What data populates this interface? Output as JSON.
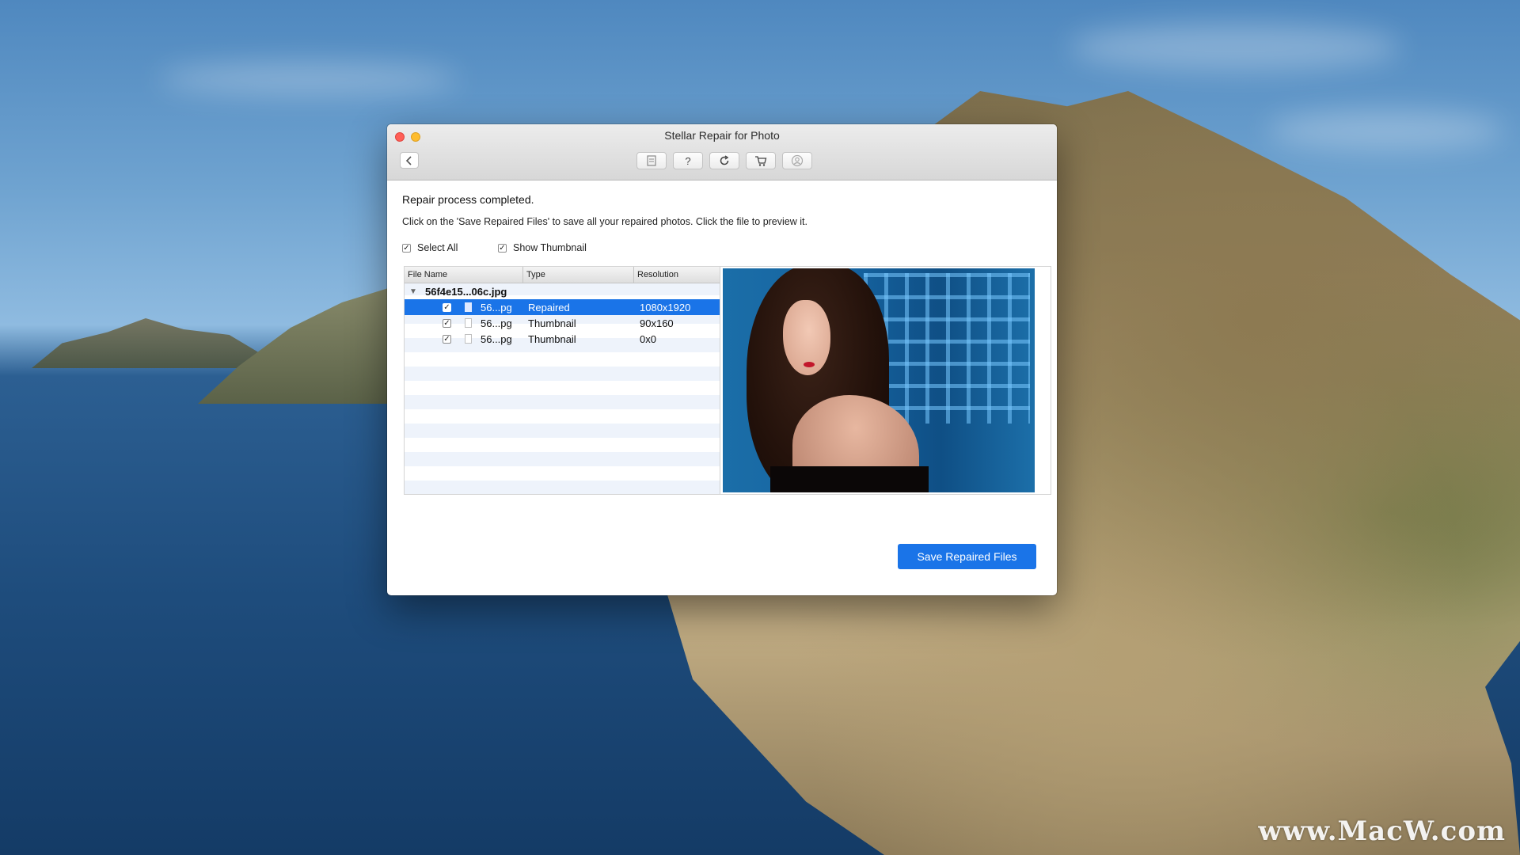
{
  "window": {
    "title": "Stellar Repair for Photo",
    "toolbar_icons": [
      "save-icon",
      "help-icon",
      "refresh-icon",
      "cart-icon",
      "account-icon"
    ]
  },
  "main": {
    "status": "Repair process completed.",
    "instruction": "Click on the 'Save Repaired Files' to save all your repaired photos. Click the file to preview it.",
    "select_all_label": "Select All",
    "show_thumbnail_label": "Show Thumbnail",
    "columns": [
      "File Name",
      "Type",
      "Resolution"
    ],
    "parent_file": "56f4e15...06c.jpg",
    "rows": [
      {
        "name": "56...pg",
        "type": "Repaired",
        "resolution": "1080x1920",
        "checked": "✓",
        "selected": true
      },
      {
        "name": "56...pg",
        "type": "Thumbnail",
        "resolution": "90x160",
        "checked": "✓"
      },
      {
        "name": "56...pg",
        "type": "Thumbnail",
        "resolution": "0x0",
        "checked": "✓"
      }
    ],
    "save_button": "Save Repaired Files"
  },
  "desktop": {
    "watermark": "www.MacW.com"
  },
  "colors": {
    "accent": "#1a74e8",
    "close": "#ff5f57",
    "minimize": "#febc2e"
  }
}
